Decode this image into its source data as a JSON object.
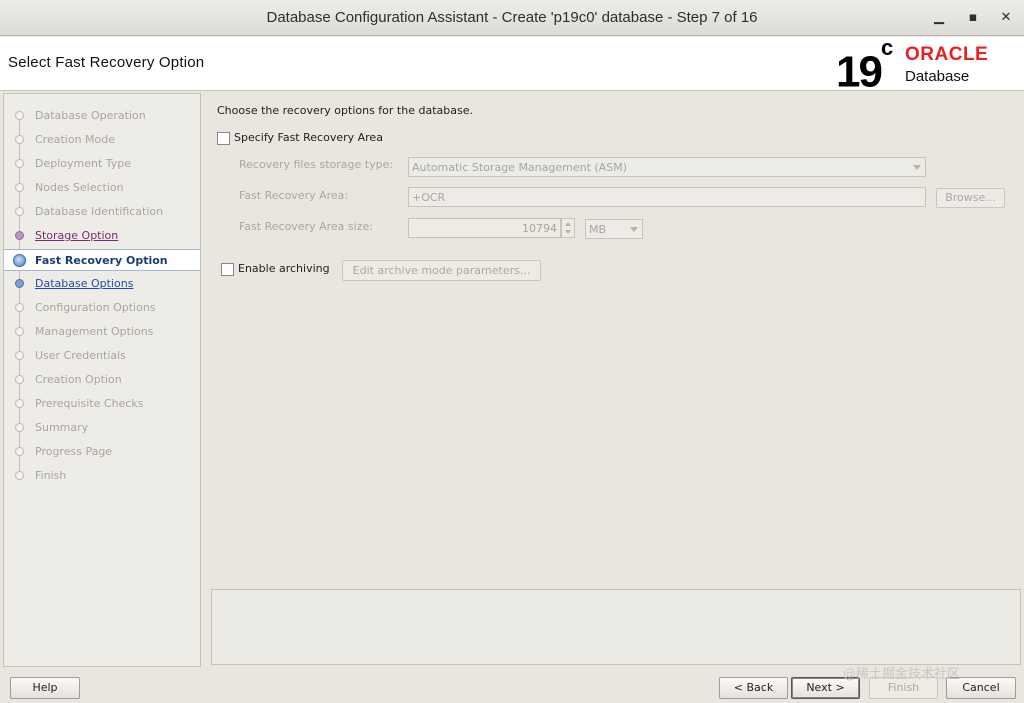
{
  "window": {
    "title": "Database Configuration Assistant - Create 'p19c0' database - Step 7 of 16",
    "minimize_glyph": "▁",
    "maximize_glyph": "▪",
    "close_glyph": "✕"
  },
  "header": {
    "page_title": "Select Fast Recovery Option",
    "logo": {
      "version": "19",
      "version_suffix": "c",
      "brand": "ORACLE",
      "product": "Database",
      "brand_color": "#e8211f"
    }
  },
  "nav": {
    "items": [
      {
        "label": "Database Operation",
        "state": "disabled"
      },
      {
        "label": "Creation Mode",
        "state": "disabled"
      },
      {
        "label": "Deployment Type",
        "state": "disabled"
      },
      {
        "label": "Nodes Selection",
        "state": "disabled"
      },
      {
        "label": "Database Identification",
        "state": "disabled"
      },
      {
        "label": "Storage Option",
        "state": "visited"
      },
      {
        "label": "Fast Recovery Option",
        "state": "current"
      },
      {
        "label": "Database Options",
        "state": "link"
      },
      {
        "label": "Configuration Options",
        "state": "disabled"
      },
      {
        "label": "Management Options",
        "state": "disabled"
      },
      {
        "label": "User Credentials",
        "state": "disabled"
      },
      {
        "label": "Creation Option",
        "state": "disabled"
      },
      {
        "label": "Prerequisite Checks",
        "state": "disabled"
      },
      {
        "label": "Summary",
        "state": "disabled"
      },
      {
        "label": "Progress Page",
        "state": "disabled"
      },
      {
        "label": "Finish",
        "state": "disabled"
      }
    ]
  },
  "content": {
    "intro": "Choose the recovery options for the database.",
    "specify_fra": {
      "label": "Specify Fast Recovery Area",
      "checked": false
    },
    "storage_type": {
      "label": "Recovery files storage type:",
      "value": "Automatic Storage Management (ASM)"
    },
    "fra": {
      "label": "Fast Recovery Area:",
      "value": "+OCR",
      "browse_label": "Browse..."
    },
    "fra_size": {
      "label": "Fast Recovery Area size:",
      "value": "10794",
      "unit": "MB"
    },
    "archiving": {
      "label": "Enable archiving",
      "checked": false,
      "edit_label": "Edit archive mode parameters..."
    }
  },
  "footer": {
    "help": "Help",
    "back": "< Back",
    "next": "Next >",
    "finish": "Finish",
    "cancel": "Cancel"
  },
  "watermark": "@稀土掘金技术社区"
}
